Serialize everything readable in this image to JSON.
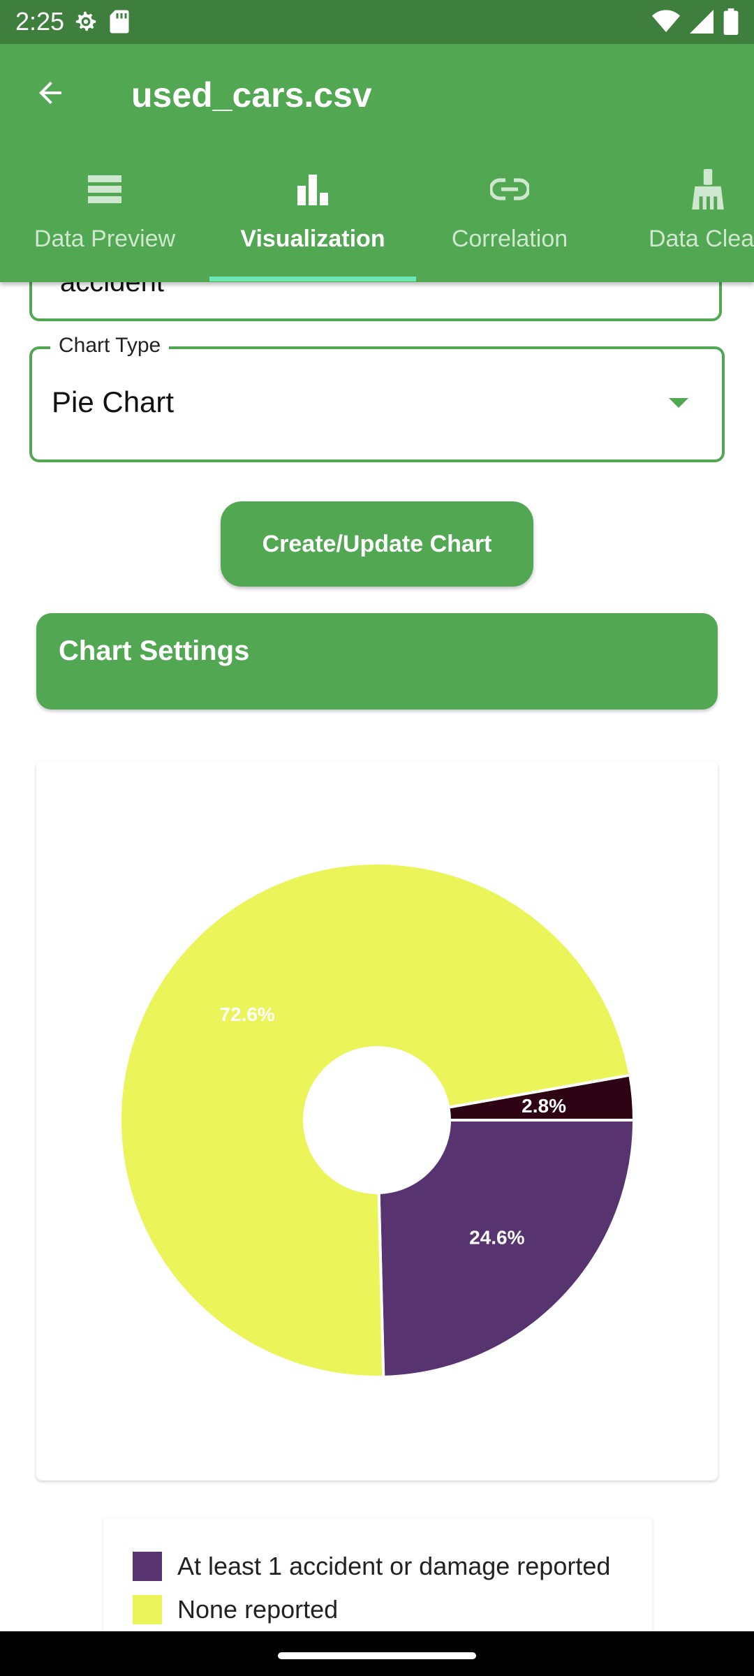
{
  "status_bar": {
    "time": "2:25",
    "left_icons": [
      "settings-icon",
      "sd-card-icon"
    ],
    "right_icons": [
      "wifi-icon",
      "signal-icon",
      "battery-icon"
    ]
  },
  "app_bar": {
    "title": "used_cars.csv",
    "back_icon": "arrow-back-icon"
  },
  "tabs": [
    {
      "label": "Data Preview",
      "icon": "list-icon",
      "active": false
    },
    {
      "label": "Visualization",
      "icon": "bar-chart-icon",
      "active": true
    },
    {
      "label": "Correlation",
      "icon": "link-icon",
      "active": false
    },
    {
      "label": "Data Clean",
      "icon": "broom-icon",
      "active": false
    }
  ],
  "column_field": {
    "value": "accident"
  },
  "chart_type_field": {
    "label": "Chart Type",
    "value": "Pie Chart"
  },
  "create_button": {
    "label": "Create/Update Chart"
  },
  "chart_settings": {
    "title": "Chart Settings"
  },
  "colors": {
    "accent": "#52a852",
    "status_bar": "#3e7f3e",
    "indicator": "#6ee7b7"
  },
  "chart_data": {
    "type": "pie",
    "donut": true,
    "slices": [
      {
        "label": "At least 1 accident or damage reported",
        "value": 24.6,
        "display": "24.6%",
        "color": "#573370"
      },
      {
        "label": "None reported",
        "value": 72.6,
        "display": "72.6%",
        "color": "#ebf55a"
      },
      {
        "label": "",
        "value": 2.8,
        "display": "2.8%",
        "color": "#2e0414"
      }
    ],
    "legend": [
      {
        "label": "At least 1 accident or damage reported",
        "color": "#573370"
      },
      {
        "label": "None reported",
        "color": "#ebf55a"
      }
    ],
    "legend_position": "bottom"
  }
}
